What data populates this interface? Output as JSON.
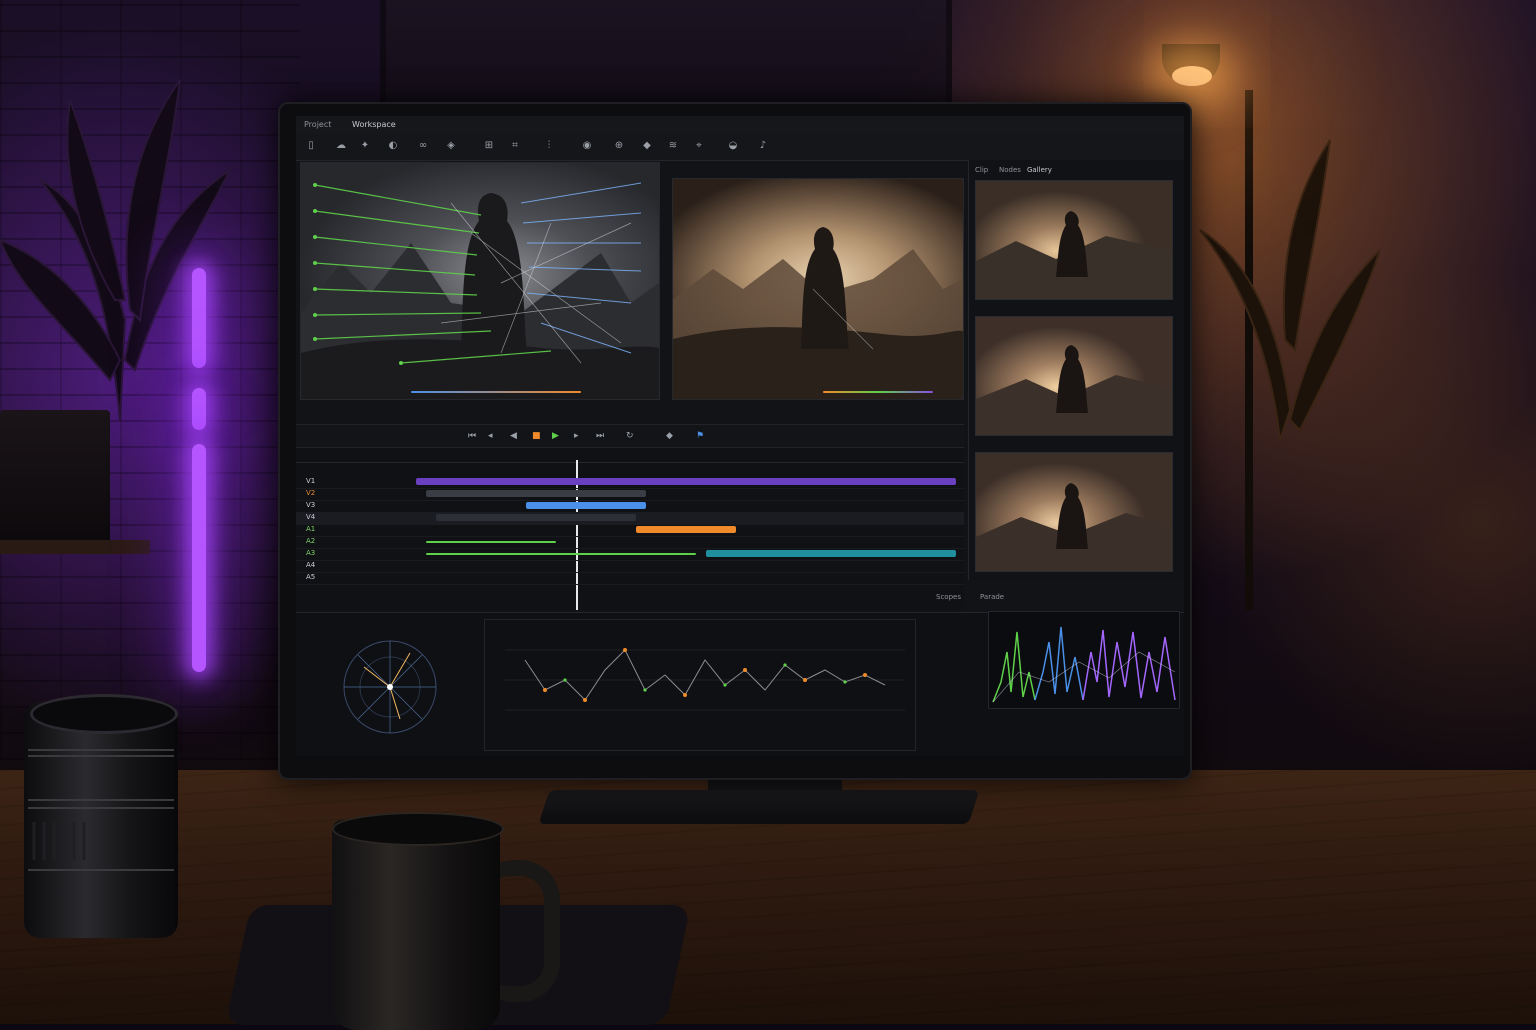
{
  "app": {
    "menu": [
      "Project",
      "Workspace"
    ],
    "panel_tabs": [
      "Clip",
      "Nodes",
      "Gallery"
    ]
  },
  "toolbar": {
    "icons": [
      "clip-icon",
      "cloud-icon",
      "wand-icon",
      "effect-icon",
      "link-icon",
      "node-icon",
      "grid-icon",
      "crop-icon",
      "split-icon",
      "eye-icon",
      "tracker-icon",
      "keyframe-icon",
      "blur-icon",
      "stabilize-icon",
      "color-icon",
      "audio-icon"
    ]
  },
  "transport": {
    "icons": [
      "skip-back-icon",
      "step-back-icon",
      "play-reverse-icon",
      "stop-icon",
      "play-icon",
      "step-forward-icon",
      "skip-forward-icon",
      "loop-icon",
      "marker-icon",
      "flag-icon"
    ]
  },
  "timeline": {
    "tracks": [
      {
        "name": "V1",
        "color": "#c9cdd4"
      },
      {
        "name": "V2",
        "color": "#e88a36"
      },
      {
        "name": "V3",
        "color": "#c9cdd4"
      },
      {
        "name": "V4",
        "color": "#c9cdd4"
      },
      {
        "name": "A1",
        "color": "#7fd46a"
      },
      {
        "name": "A2",
        "color": "#7fd46a"
      },
      {
        "name": "A3",
        "color": "#7fd46a"
      },
      {
        "name": "A4",
        "color": "#c9cdd4"
      },
      {
        "name": "A5",
        "color": "#c9cdd4"
      }
    ]
  },
  "scopes": {
    "panel_label": "Scopes",
    "parade_label": "Parade"
  },
  "colors": {
    "accent_purple": "#8a4fe0",
    "accent_green": "#5fd04a",
    "accent_orange": "#f08a2a",
    "accent_teal": "#1f8fa0",
    "accent_blue": "#4a8fe8"
  }
}
